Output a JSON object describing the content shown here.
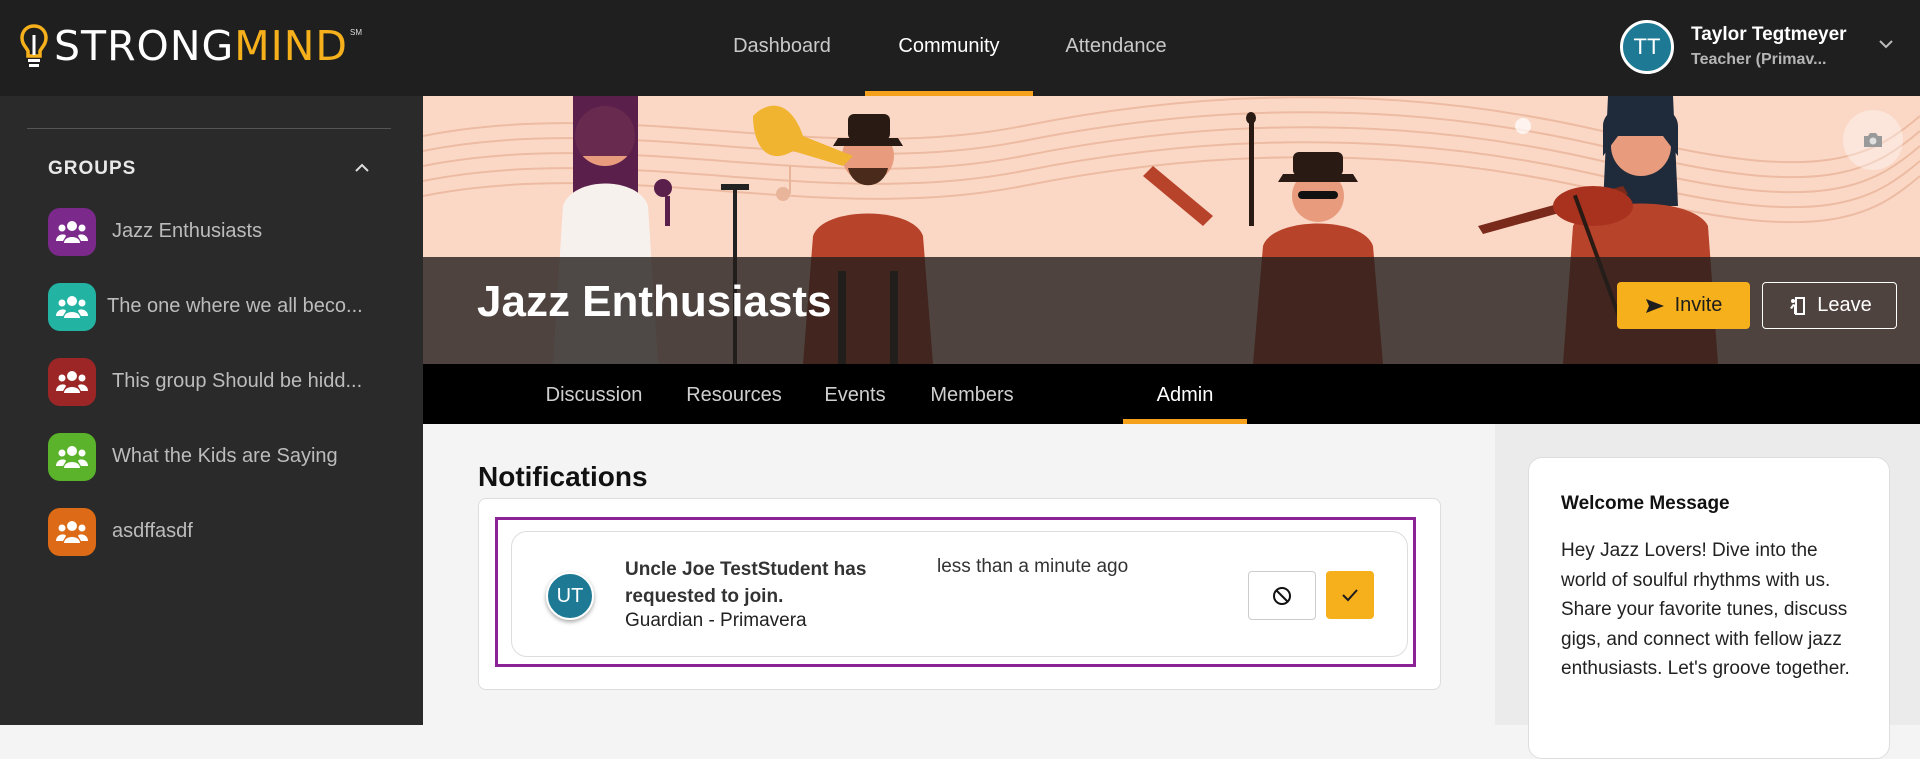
{
  "app": {
    "logo_part1": "STRONG",
    "logo_part2": "MIND",
    "logo_mark": "SM"
  },
  "topnav": {
    "items": [
      {
        "label": "Dashboard",
        "active": false
      },
      {
        "label": "Community",
        "active": true
      },
      {
        "label": "Attendance",
        "active": false
      }
    ]
  },
  "user": {
    "initials": "TT",
    "name": "Taylor Tegtmeyer",
    "role": "Teacher (Primav..."
  },
  "sidebar": {
    "heading": "GROUPS",
    "groups": [
      {
        "label": "Jazz Enthusiasts",
        "color": "#7b2a8c"
      },
      {
        "label": "The one where we all beco...",
        "color": "#22b3a3"
      },
      {
        "label": "This group Should be hidd...",
        "color": "#9c2626"
      },
      {
        "label": "What the Kids are Saying",
        "color": "#5ab32a"
      },
      {
        "label": "asdffasdf",
        "color": "#dd6a16"
      }
    ]
  },
  "group": {
    "title": "Jazz Enthusiasts",
    "invite_label": "Invite",
    "leave_label": "Leave"
  },
  "tabs": [
    {
      "label": "Discussion",
      "active": false
    },
    {
      "label": "Resources",
      "active": false
    },
    {
      "label": "Events",
      "active": false
    },
    {
      "label": "Members",
      "active": false
    },
    {
      "label": "Admin",
      "active": true
    }
  ],
  "notifications": {
    "title": "Notifications",
    "items": [
      {
        "initials": "UT",
        "message": "Uncle Joe TestStudent has requested to join.",
        "role": "Guardian - Primavera",
        "time": "less than a minute ago"
      }
    ]
  },
  "welcome": {
    "title": "Welcome Message",
    "body": "Hey Jazz Lovers! Dive into the world of soulful rhythms with us. Share your favorite tunes, discuss gigs, and connect with fellow jazz enthusiasts. Let's groove together."
  },
  "colors": {
    "accent": "#f5b01c",
    "avatar": "#1e7a94",
    "highlight": "#8b2396"
  }
}
